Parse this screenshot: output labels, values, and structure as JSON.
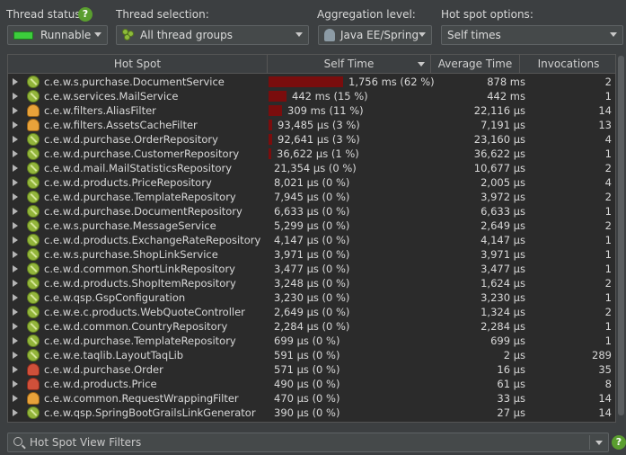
{
  "toolbar": {
    "thread_status_label": "Thread status:",
    "thread_status_value": "Runnable",
    "thread_selection_label": "Thread selection:",
    "thread_selection_value": "All thread groups",
    "aggregation_label": "Aggregation level:",
    "aggregation_value": "Java EE/Spring",
    "hotspot_options_label": "Hot spot options:",
    "hotspot_options_value": "Self times",
    "help_glyph": "?"
  },
  "colors": {
    "background": "#3c3f41",
    "table_background": "#2b2b2b",
    "bar": "#7a0d0d",
    "runnable_green": "#3ccd3c",
    "help_green": "#5a9e2f"
  },
  "table": {
    "columns": [
      "Hot Spot",
      "Self Time",
      "Average Time",
      "Invocations"
    ],
    "rows": [
      {
        "name": "c.e.w.s.purchase.DocumentService",
        "icon": "green",
        "self": "1,756 ms (62 %)",
        "pct": 62,
        "avg": "878 ms",
        "inv": "2"
      },
      {
        "name": "c.e.w.services.MailService",
        "icon": "green",
        "self": "442 ms (15 %)",
        "pct": 15,
        "avg": "442 ms",
        "inv": "1"
      },
      {
        "name": "c.e.w.filters.AliasFilter",
        "icon": "orange",
        "self": "309 ms (11 %)",
        "pct": 11,
        "avg": "22,116 µs",
        "inv": "14"
      },
      {
        "name": "c.e.w.filters.AssetsCacheFilter",
        "icon": "orange",
        "self": "93,485 µs (3 %)",
        "pct": 3,
        "avg": "7,191 µs",
        "inv": "13"
      },
      {
        "name": "c.e.w.d.purchase.OrderRepository",
        "icon": "green",
        "self": "92,641 µs (3 %)",
        "pct": 3,
        "avg": "23,160 µs",
        "inv": "4"
      },
      {
        "name": "c.e.w.d.purchase.CustomerRepository",
        "icon": "green",
        "self": "36,622 µs (1 %)",
        "pct": 1,
        "avg": "36,622 µs",
        "inv": "1"
      },
      {
        "name": "c.e.w.d.mail.MailStatisticsRepository",
        "icon": "green",
        "self": "21,354 µs (0 %)",
        "pct": 0,
        "avg": "10,677 µs",
        "inv": "2"
      },
      {
        "name": "c.e.w.d.products.PriceRepository",
        "icon": "green",
        "self": "8,021 µs (0 %)",
        "pct": 0,
        "avg": "2,005 µs",
        "inv": "4"
      },
      {
        "name": "c.e.w.d.purchase.TemplateRepository",
        "icon": "green",
        "self": "7,945 µs (0 %)",
        "pct": 0,
        "avg": "3,972 µs",
        "inv": "2"
      },
      {
        "name": "c.e.w.d.purchase.DocumentRepository",
        "icon": "green",
        "self": "6,633 µs (0 %)",
        "pct": 0,
        "avg": "6,633 µs",
        "inv": "1"
      },
      {
        "name": "c.e.w.s.purchase.MessageService",
        "icon": "green",
        "self": "5,299 µs (0 %)",
        "pct": 0,
        "avg": "2,649 µs",
        "inv": "2"
      },
      {
        "name": "c.e.w.d.products.ExchangeRateRepository",
        "icon": "green",
        "self": "4,147 µs (0 %)",
        "pct": 0,
        "avg": "4,147 µs",
        "inv": "1"
      },
      {
        "name": "c.e.w.s.purchase.ShopLinkService",
        "icon": "green",
        "self": "3,971 µs (0 %)",
        "pct": 0,
        "avg": "3,971 µs",
        "inv": "1"
      },
      {
        "name": "c.e.w.d.common.ShortLinkRepository",
        "icon": "green",
        "self": "3,477 µs (0 %)",
        "pct": 0,
        "avg": "3,477 µs",
        "inv": "1"
      },
      {
        "name": "c.e.w.d.products.ShopItemRepository",
        "icon": "green",
        "self": "3,248 µs (0 %)",
        "pct": 0,
        "avg": "1,624 µs",
        "inv": "2"
      },
      {
        "name": "c.e.w.qsp.GspConfiguration",
        "icon": "green",
        "self": "3,230 µs (0 %)",
        "pct": 0,
        "avg": "3,230 µs",
        "inv": "1"
      },
      {
        "name": "c.e.w.e.c.products.WebQuoteController",
        "icon": "green",
        "self": "2,649 µs (0 %)",
        "pct": 0,
        "avg": "1,324 µs",
        "inv": "2"
      },
      {
        "name": "c.e.w.d.common.CountryRepository",
        "icon": "green",
        "self": "2,284 µs (0 %)",
        "pct": 0,
        "avg": "2,284 µs",
        "inv": "1"
      },
      {
        "name": "c.e.w.d.purchase.TemplateRepository",
        "icon": "green",
        "self": "699 µs (0 %)",
        "pct": 0,
        "avg": "699 µs",
        "inv": "1"
      },
      {
        "name": "c.e.w.e.taqlib.LayoutTaqLib",
        "icon": "green",
        "self": "591 µs (0 %)",
        "pct": 0,
        "avg": "2 µs",
        "inv": "289"
      },
      {
        "name": "c.e.w.d.purchase.Order",
        "icon": "red",
        "self": "571 µs (0 %)",
        "pct": 0,
        "avg": "16 µs",
        "inv": "35"
      },
      {
        "name": "c.e.w.d.products.Price",
        "icon": "red",
        "self": "490 µs (0 %)",
        "pct": 0,
        "avg": "61 µs",
        "inv": "8"
      },
      {
        "name": "c.e.w.common.RequestWrappingFilter",
        "icon": "orange",
        "self": "470 µs (0 %)",
        "pct": 0,
        "avg": "33 µs",
        "inv": "14"
      },
      {
        "name": "c.e.w.qsp.SpringBootGrailsLinkGenerator",
        "icon": "green",
        "self": "390 µs (0 %)",
        "pct": 0,
        "avg": "27 µs",
        "inv": "14"
      }
    ]
  },
  "filter": {
    "placeholder": "Hot Spot View Filters"
  }
}
